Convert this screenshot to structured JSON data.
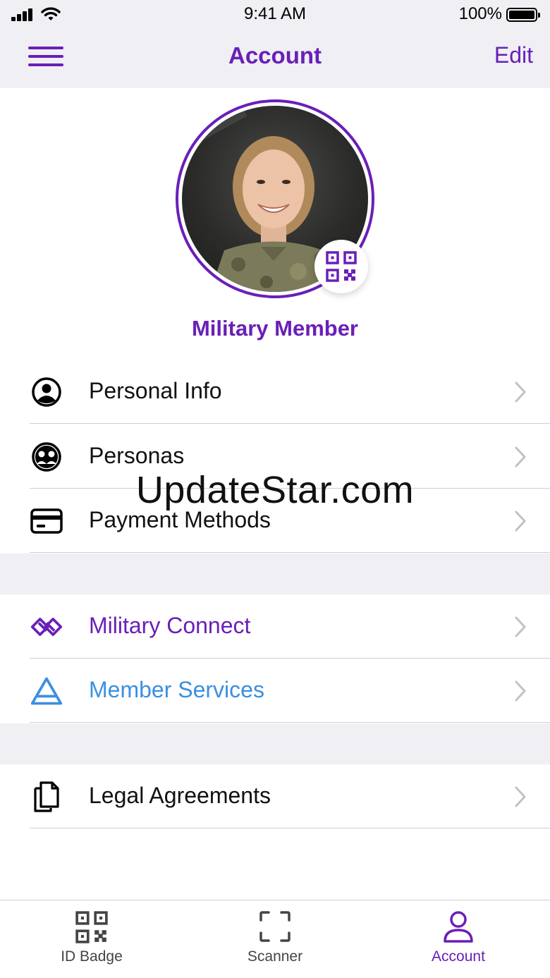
{
  "status_bar": {
    "time": "9:41 AM",
    "battery": "100%"
  },
  "nav": {
    "title": "Account",
    "edit_label": "Edit",
    "menu_icon": "hamburger-menu-icon"
  },
  "profile": {
    "name": "Military Member",
    "qr_icon": "qr-code-icon"
  },
  "menu_sections": [
    [
      {
        "label": "Personal Info",
        "icon": "person-circle-icon"
      },
      {
        "label": "Personas",
        "icon": "personas-icon"
      },
      {
        "label": "Payment Methods",
        "icon": "credit-card-icon"
      }
    ],
    [
      {
        "label": "Military Connect",
        "icon": "military-connect-icon",
        "color": "#6a1fb8"
      },
      {
        "label": "Member Services",
        "icon": "triangle-icon",
        "color": "#3c8fe0"
      }
    ],
    [
      {
        "label": "Legal Agreements",
        "icon": "documents-icon"
      }
    ]
  ],
  "watermark": "UpdateStar.com",
  "tabs": [
    {
      "label": "ID Badge",
      "icon": "qr-code-icon",
      "active": false
    },
    {
      "label": "Scanner",
      "icon": "scanner-frame-icon",
      "active": false
    },
    {
      "label": "Account",
      "icon": "person-icon",
      "active": true
    }
  ],
  "colors": {
    "accent": "#6a1fb8",
    "link_blue": "#3c8fe0",
    "background_gray": "#efeff4"
  }
}
